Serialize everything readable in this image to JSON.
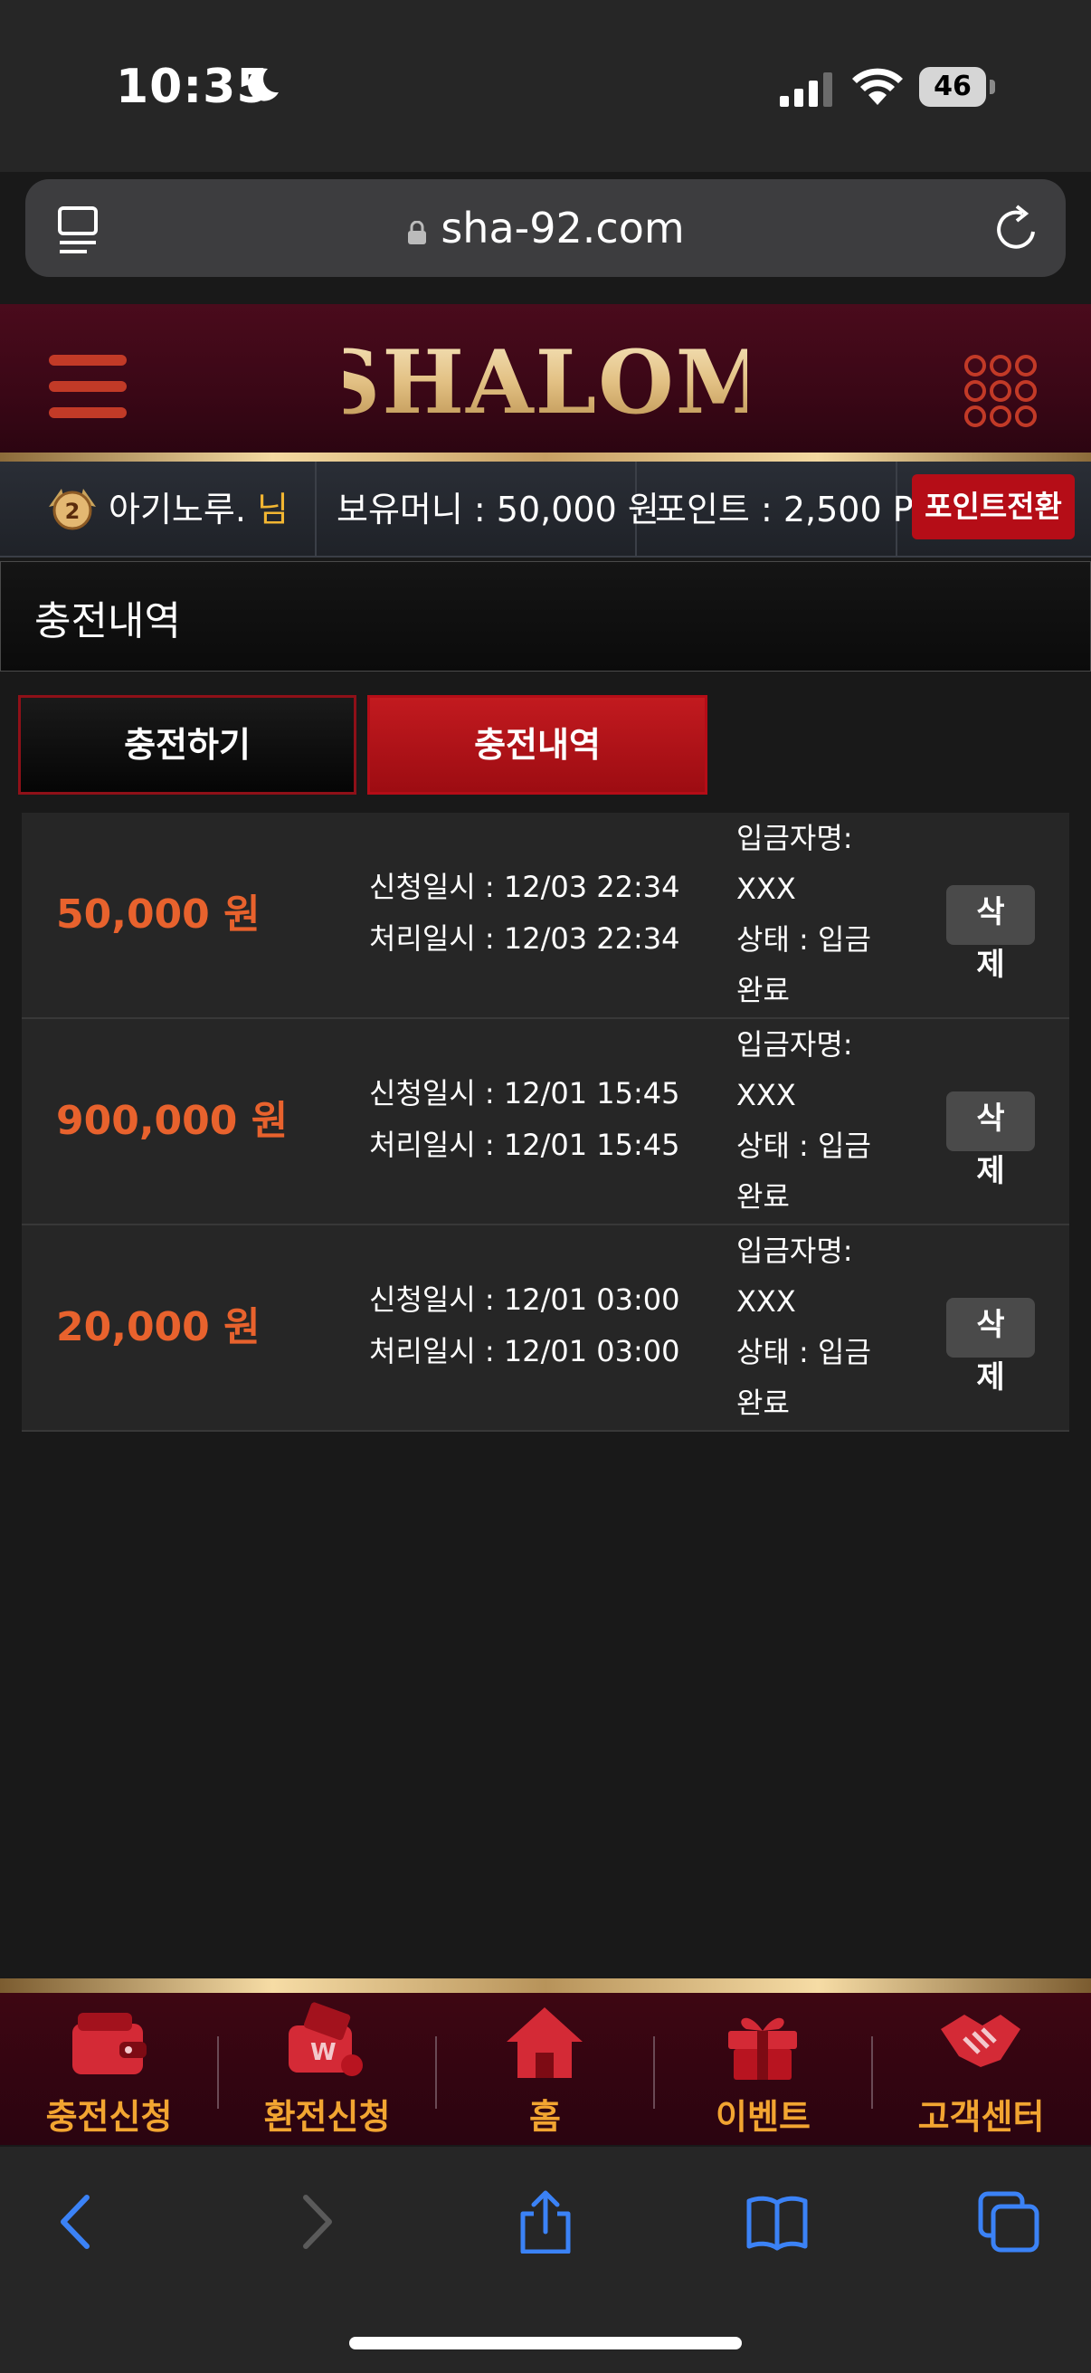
{
  "status_bar": {
    "time": "10:35",
    "battery": "46"
  },
  "browser": {
    "url": "sha-92.com"
  },
  "header": {
    "logo_text": "SHALOM"
  },
  "user_bar": {
    "username": "아기노루.",
    "honorific": "님",
    "money_label": "보유머니 : 50,000 원",
    "points_label": "포인트 : 2,500 P",
    "convert_button": "포인트전환"
  },
  "page": {
    "title": "충전내역"
  },
  "tabs": [
    {
      "label": "충전하기",
      "active": false
    },
    {
      "label": "충전내역",
      "active": true
    }
  ],
  "history": [
    {
      "amount": "50,000 원",
      "request": "신청일시 : 12/03 22:34",
      "processed": "처리일시 : 12/03 22:34",
      "depositor_label": "입금자명:",
      "depositor": "XXX",
      "status_line1": "상태 : 입금",
      "status_line2": "완료",
      "delete_1": "삭",
      "delete_2": "제"
    },
    {
      "amount": "900,000 원",
      "request": "신청일시 : 12/01 15:45",
      "processed": "처리일시 : 12/01 15:45",
      "depositor_label": "입금자명:",
      "depositor": "XXX",
      "status_line1": "상태 : 입금",
      "status_line2": "완료",
      "delete_1": "삭",
      "delete_2": "제"
    },
    {
      "amount": "20,000 원",
      "request": "신청일시 : 12/01 03:00",
      "processed": "처리일시 : 12/01 03:00",
      "depositor_label": "입금자명:",
      "depositor": "XXX",
      "status_line1": "상태 : 입금",
      "status_line2": "완료",
      "delete_1": "삭",
      "delete_2": "제"
    }
  ],
  "bottom_nav": [
    {
      "label": "충전신청",
      "icon": "wallet-icon"
    },
    {
      "label": "환전신청",
      "icon": "wallet-exchange-icon"
    },
    {
      "label": "홈",
      "icon": "home-icon"
    },
    {
      "label": "이벤트",
      "icon": "gift-icon"
    },
    {
      "label": "고객센터",
      "icon": "handshake-icon"
    }
  ],
  "colors": {
    "accent_red": "#b50d17",
    "amount_orange": "#e8622d",
    "nav_label": "#f2a531",
    "gold": "#f3d9a1"
  }
}
